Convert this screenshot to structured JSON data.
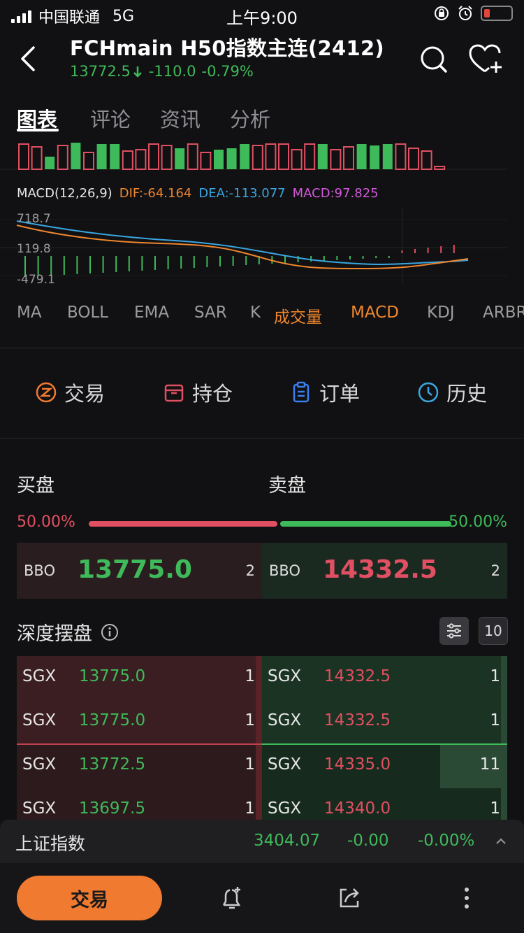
{
  "status_bar": {
    "carrier": "中国联通",
    "network": "5G",
    "time": "上午9:00"
  },
  "header": {
    "title": "FCHmain  H50指数主连(2412)",
    "price": "13772.5",
    "change": "-110.0",
    "change_pct": "-0.79%",
    "icons": [
      "back-icon",
      "search-icon",
      "favorite-add-icon"
    ]
  },
  "tabs": [
    "图表",
    "评论",
    "资讯",
    "分析"
  ],
  "chart": {
    "macd_label": "MACD(12,26,9)",
    "dif": "DIF:-64.164",
    "dea": "DEA:-113.077",
    "macd": "MACD:97.825",
    "axis": [
      "718.7",
      "119.8",
      "-479.1"
    ],
    "colors": {
      "dif": "#f0862d",
      "dea": "#3aa6e0",
      "macd": "#d05ad8"
    }
  },
  "indicators": [
    "MA",
    "BOLL",
    "EMA",
    "SAR",
    "K",
    "成交量",
    "MACD",
    "KDJ",
    "ARBR"
  ],
  "actions": [
    {
      "label": "交易",
      "icon": "trade-icon"
    },
    {
      "label": "持仓",
      "icon": "position-icon"
    },
    {
      "label": "订单",
      "icon": "order-icon"
    },
    {
      "label": "历史",
      "icon": "history-icon"
    }
  ],
  "book": {
    "bid_title": "买盘",
    "ask_title": "卖盘",
    "bid_pct": "50.00%",
    "ask_pct": "50.00%",
    "bbo_label": "BBO",
    "bbo_bid_price": "13775.0",
    "bbo_bid_qty": "2",
    "bbo_ask_price": "14332.5",
    "bbo_ask_qty": "2",
    "depth_title": "深度摆盘",
    "depth_levels": "10",
    "bids": [
      {
        "ex": "SGX",
        "price": "13775.0",
        "qty": "1"
      },
      {
        "ex": "SGX",
        "price": "13775.0",
        "qty": "1"
      },
      {
        "ex": "SGX",
        "price": "13772.5",
        "qty": "1"
      },
      {
        "ex": "SGX",
        "price": "13697.5",
        "qty": "1"
      }
    ],
    "asks": [
      {
        "ex": "SGX",
        "price": "14332.5",
        "qty": "1"
      },
      {
        "ex": "SGX",
        "price": "14332.5",
        "qty": "1"
      },
      {
        "ex": "SGX",
        "price": "14335.0",
        "qty": "11"
      },
      {
        "ex": "SGX",
        "price": "14340.0",
        "qty": "1"
      }
    ]
  },
  "ticker": {
    "name": "上证指数",
    "value": "3404.07",
    "change": "-0.00",
    "change_pct": "-0.00%"
  },
  "bottom": {
    "trade_label": "交易"
  },
  "colors": {
    "up": "#3fba5a",
    "down": "#e05062",
    "accent": "#f07a30"
  }
}
